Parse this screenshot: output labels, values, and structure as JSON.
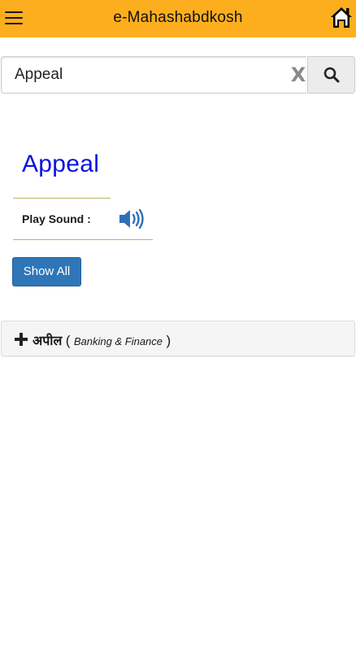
{
  "header": {
    "title": "e-Mahashabdkosh",
    "menu_icon": "hamburger-menu-icon",
    "home_icon": "home-icon",
    "background_color": "#fcae1e"
  },
  "search": {
    "value": "Appeal",
    "placeholder": "",
    "clear_label": "X",
    "search_icon": "search-icon"
  },
  "entry": {
    "word": "Appeal",
    "word_color": "#0a10e6",
    "play_sound_label": "Play Sound :",
    "speaker_icon": "speaker-icon",
    "show_all_label": "Show All"
  },
  "meanings": [
    {
      "expand_icon": "plus-icon",
      "word": "अपील",
      "open_paren": "(",
      "domain": "Banking & Finance",
      "close_paren": ")"
    }
  ]
}
